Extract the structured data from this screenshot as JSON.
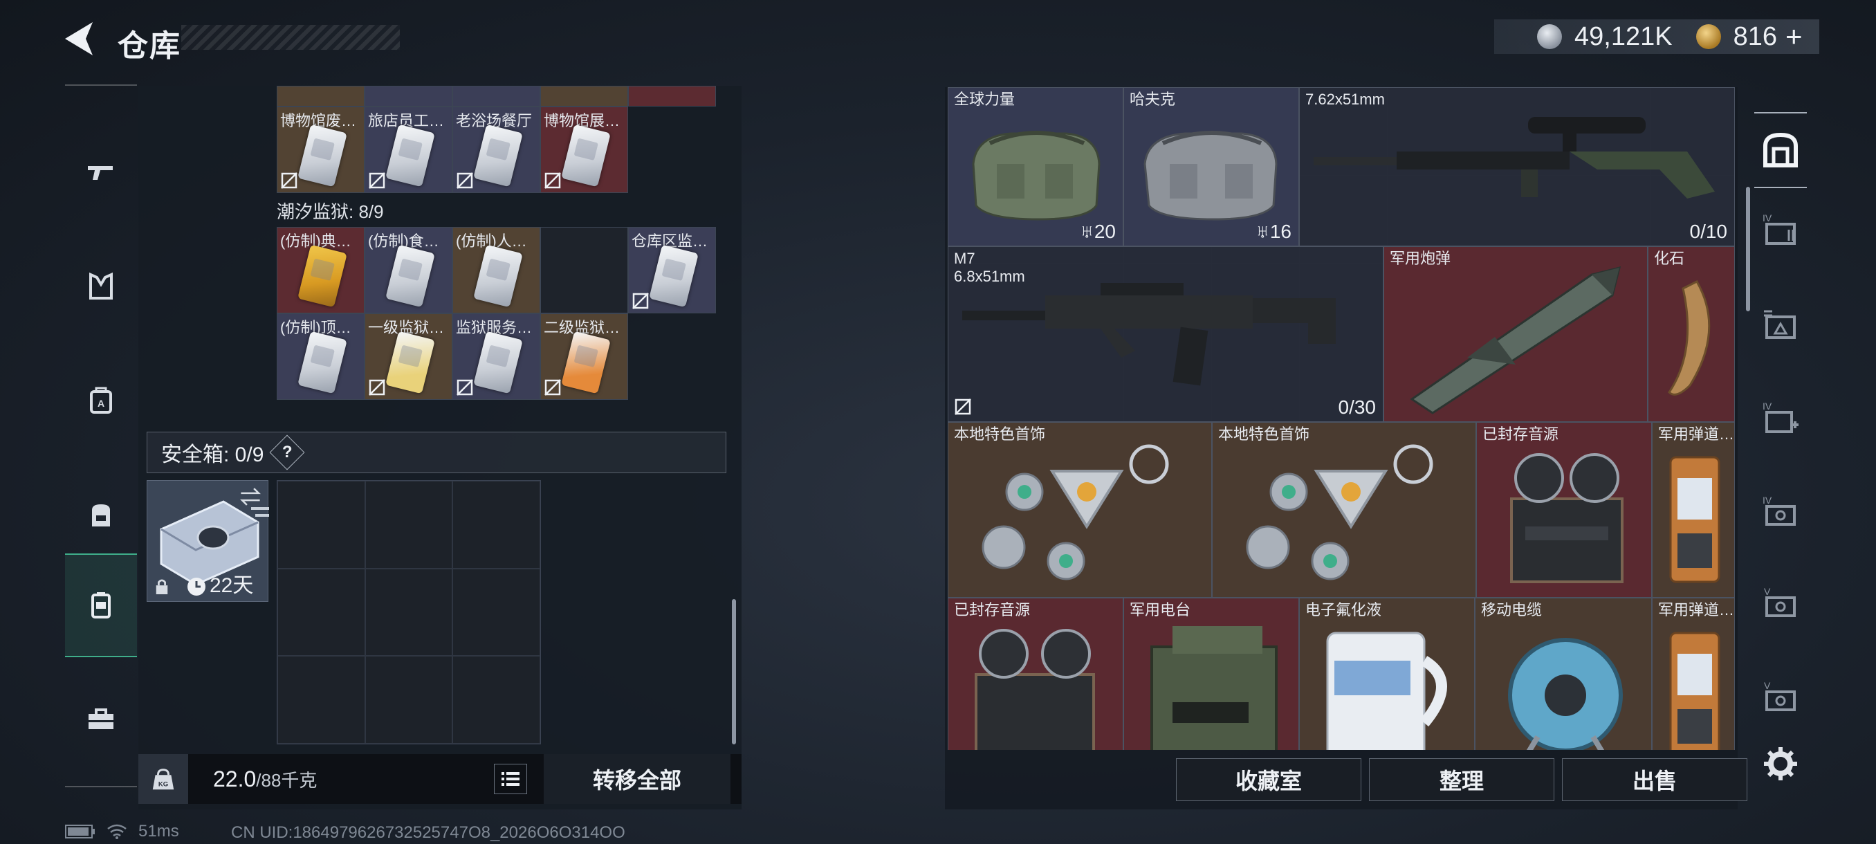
{
  "header": {
    "title": "仓库",
    "currency_a": "49,121K",
    "currency_b": "816",
    "add_symbol": "+"
  },
  "left_nav": {
    "items": [
      "pistol-icon",
      "vest-icon",
      "backpack-armor-icon",
      "backpack-icon",
      "case-icon",
      "toolbox-icon"
    ]
  },
  "stash": {
    "top_row": [
      {
        "label": "博物馆废…",
        "color": "brown"
      },
      {
        "label": "旅店员工…",
        "color": "purple"
      },
      {
        "label": "老浴场餐厅",
        "color": "purple"
      },
      {
        "label": "博物馆展…",
        "color": "red"
      }
    ],
    "prison_title": "潮汐监狱: 8/9",
    "prison_row1": [
      {
        "label": "(仿制)典…",
        "color": "red",
        "gold": true
      },
      {
        "label": "(仿制)食…",
        "color": "purple"
      },
      {
        "label": "(仿制)人…",
        "color": "brown"
      },
      {
        "label": "",
        "color": "empty"
      },
      {
        "label": "仓库区监…",
        "color": "purple"
      }
    ],
    "prison_row2": [
      {
        "label": "(仿制)顶…",
        "color": "purple"
      },
      {
        "label": "一级监狱…",
        "color": "brown"
      },
      {
        "label": "监狱服务…",
        "color": "purple"
      },
      {
        "label": "二级监狱…",
        "color": "brown"
      }
    ]
  },
  "safe_box": {
    "title": "安全箱: 0/9",
    "help": "?",
    "item_time": "22天"
  },
  "weight": {
    "current": "22.0",
    "max": "/88千克"
  },
  "actions": {
    "transfer_all": "转移全部",
    "collection": "收藏室",
    "sort": "整理",
    "sell": "出售"
  },
  "status": {
    "ping": "51ms",
    "uid": "CN UID:1864979626732525747O8_2026O6O314OO"
  },
  "warehouse": {
    "items": [
      {
        "label": "全球力量",
        "sub": "",
        "count": "20",
        "count_prefix": "♅",
        "color": "dark"
      },
      {
        "label": "哈夫克",
        "sub": "",
        "count": "16",
        "count_prefix": "♅",
        "color": "dark"
      },
      {
        "label": "7.62x51mm",
        "sub": "",
        "count": "0/10",
        "color": "dark"
      },
      {
        "label": "M7",
        "sub": "6.8x51mm",
        "count": "0/30",
        "color": "dark"
      },
      {
        "label": "军用炮弹",
        "sub": "",
        "count": "",
        "color": "red"
      },
      {
        "label": "化石",
        "sub": "",
        "count": "",
        "color": "red"
      },
      {
        "label": "本地特色首饰",
        "sub": "",
        "count": "",
        "color": "brown"
      },
      {
        "label": "本地特色首饰",
        "sub": "",
        "count": "",
        "color": "brown"
      },
      {
        "label": "已封存音源",
        "sub": "",
        "count": "",
        "color": "red"
      },
      {
        "label": "军用弹道…",
        "sub": "",
        "count": "",
        "color": "brown"
      },
      {
        "label": "已封存音源",
        "sub": "",
        "count": "",
        "color": "red"
      },
      {
        "label": "军用电台",
        "sub": "",
        "count": "",
        "color": "red"
      },
      {
        "label": "电子氟化液",
        "sub": "",
        "count": "",
        "color": "brown"
      },
      {
        "label": "移动电缆",
        "sub": "",
        "count": "",
        "color": "brown"
      },
      {
        "label": "军用弹道…",
        "sub": "",
        "count": "",
        "color": "brown"
      }
    ]
  },
  "right_nav": {
    "items": [
      "warehouse-icon",
      "storage-iv-1-icon",
      "storage-iv-2-icon",
      "storage-iv-3-icon",
      "storage-iv-4-icon",
      "storage-v-1-icon",
      "storage-v-2-icon",
      "settings-icon"
    ]
  },
  "colors": {
    "accent": "#3fae8a",
    "red_rarity": "#5a2930",
    "gold_rarity": "#4a3b30",
    "purple_rarity": "#353a52"
  }
}
